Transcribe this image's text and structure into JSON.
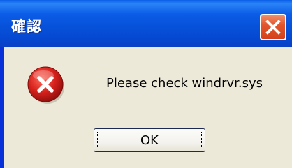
{
  "dialog": {
    "title": "確認",
    "message": "Please check windrvr.sys",
    "ok_label": "OK",
    "icon": "error-icon",
    "close_icon": "close-icon"
  },
  "colors": {
    "titlebar": "#0750d8",
    "close_button": "#e2562c",
    "client_background": "#ece9d8",
    "error_icon": "#d6211b"
  }
}
